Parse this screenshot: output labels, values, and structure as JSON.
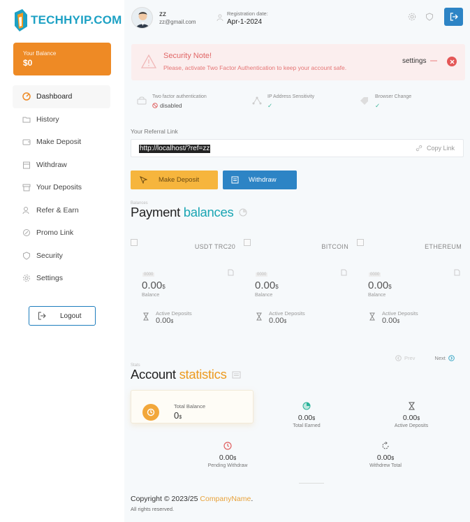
{
  "brand": {
    "name": "TECHHYIP.COM"
  },
  "sidebar": {
    "balance_label": "Your Balance",
    "balance_value": "$0",
    "items": [
      {
        "label": "Dashboard"
      },
      {
        "label": "History"
      },
      {
        "label": "Make Deposit"
      },
      {
        "label": "Withdraw"
      },
      {
        "label": "Your Deposits"
      },
      {
        "label": "Refer & Earn"
      },
      {
        "label": "Promo Link"
      },
      {
        "label": "Security"
      },
      {
        "label": "Settings"
      }
    ],
    "logout_label": "Logout"
  },
  "user": {
    "name": "zz",
    "email": "zz@gmail.com",
    "reg_label": "Registration date:",
    "reg_date": "Apr-1-2024"
  },
  "alert": {
    "title": "Security Note!",
    "message": "Please, activate Two Factor Authentication to keep your account safe.",
    "link": "settings"
  },
  "security": {
    "items": [
      {
        "label": "Two factor authentication",
        "value": "disabled"
      },
      {
        "label": "IP Address Sensitivity",
        "value": "✓"
      },
      {
        "label": "Browser Change",
        "value": "✓"
      }
    ]
  },
  "referral": {
    "label": "Your Referral Link",
    "url": "http://localhost/?ref=zz",
    "copy_label": "Copy Link"
  },
  "actions": {
    "deposit_label": "Make Deposit",
    "withdraw_label": "Withdraw"
  },
  "payment": {
    "ghost": "Balances",
    "title_a": "Payment ",
    "title_b": "balances",
    "coins": [
      {
        "name": "USDT TRC20",
        "small": "0000",
        "balance": "0.00",
        "unit": "$",
        "balance_label": "Balance",
        "active_label": "Active Deposits",
        "active": "0.00"
      },
      {
        "name": "BITCOIN",
        "small": "0000",
        "balance": "0.00",
        "unit": "$",
        "balance_label": "Balance",
        "active_label": "Active Deposits",
        "active": "0.00"
      },
      {
        "name": "ETHEREUM",
        "small": "0000",
        "balance": "0.00",
        "unit": "$",
        "balance_label": "Balance",
        "active_label": "Active Deposits",
        "active": "0.00"
      }
    ],
    "prev": "Prev",
    "next": "Next"
  },
  "stats": {
    "ghost": "Stats",
    "title_a": "Account ",
    "title_b": "statistics",
    "total_balance_label": "Total Balance",
    "total_balance": "0",
    "unit": "$",
    "items": [
      {
        "label": "Total Earned",
        "value": "0.00"
      },
      {
        "label": "Active Deposits",
        "value": "0.00"
      },
      {
        "label": "Pending Withdraw",
        "value": "0.00"
      },
      {
        "label": "Withdrew Total",
        "value": "0.00"
      }
    ]
  },
  "footer": {
    "copy": "Copyright © 2023/25 ",
    "company": "CompanyName",
    "dot": ".",
    "rights": "All rights reserved."
  },
  "colors": {
    "accent_orange": "#ee8a25",
    "accent_blue": "#2d84c5",
    "teal": "#1aa5b3",
    "alert_red": "#e45757"
  }
}
